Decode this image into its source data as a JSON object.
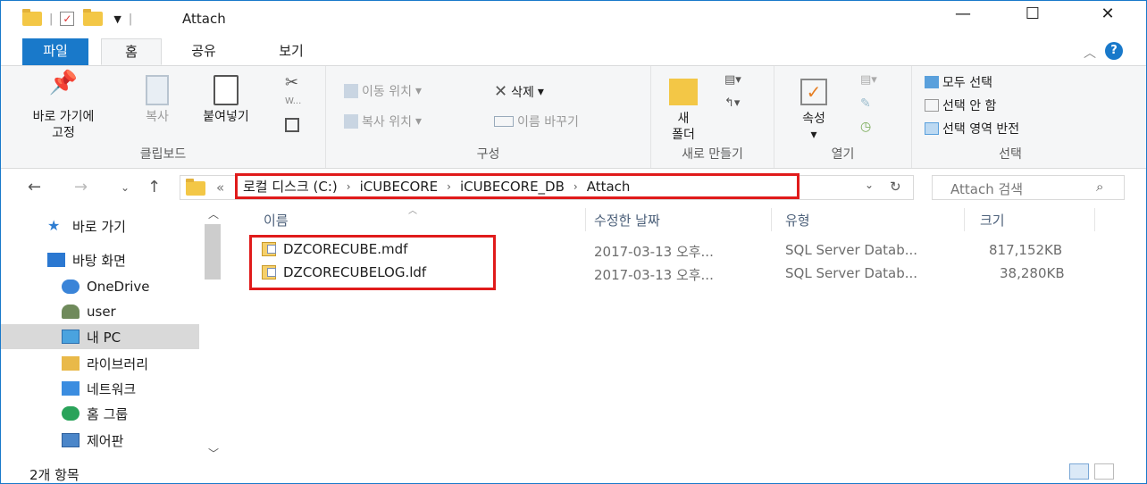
{
  "window": {
    "title": "Attach",
    "minimize": "—",
    "maximize": "☐",
    "close": "✕"
  },
  "tabs": [
    {
      "label": "파일"
    },
    {
      "label": "홈"
    },
    {
      "label": "공유"
    },
    {
      "label": "보기"
    }
  ],
  "ribbon": {
    "clipboard": {
      "pin_line1": "바로 가기에",
      "pin_line2": "고정",
      "copy": "복사",
      "paste": "붙여넣기",
      "group": "클립보드"
    },
    "organize": {
      "move_to": "이동 위치",
      "copy_to": "복사 위치",
      "delete": "삭제",
      "rename": "이름 바꾸기",
      "group": "구성"
    },
    "new": {
      "new_folder_line1": "새",
      "new_folder_line2": "폴더",
      "group": "새로 만들기"
    },
    "open": {
      "properties": "속성",
      "group": "열기"
    },
    "select": {
      "select_all": "모두 선택",
      "select_none": "선택 안 함",
      "invert": "선택 영역 반전",
      "group": "선택"
    }
  },
  "address": {
    "prefix": "«",
    "crumbs": [
      "로컬 디스크 (C:)",
      "iCUBECORE",
      "iCUBECORE_DB",
      "Attach"
    ],
    "search_placeholder": "Attach 검색"
  },
  "nav": [
    {
      "label": "바로 가기",
      "icon": "star-icon"
    },
    {
      "label": "바탕 화면",
      "icon": "desktop-icon"
    },
    {
      "label": "OneDrive",
      "icon": "cloud-icon"
    },
    {
      "label": "user",
      "icon": "user-icon"
    },
    {
      "label": "내 PC",
      "icon": "pc-icon"
    },
    {
      "label": "라이브러리",
      "icon": "library-icon"
    },
    {
      "label": "네트워크",
      "icon": "network-icon"
    },
    {
      "label": "홈 그룹",
      "icon": "homegroup-icon"
    },
    {
      "label": "제어판",
      "icon": "control-panel-icon"
    }
  ],
  "columns": {
    "name": "이름",
    "date": "수정한 날짜",
    "type": "유형",
    "size": "크기"
  },
  "files": [
    {
      "name": "DZCORECUBE.mdf",
      "date": "2017-03-13 오후...",
      "type": "SQL Server Datab...",
      "size": "817,152KB"
    },
    {
      "name": "DZCORECUBELOG.ldf",
      "date": "2017-03-13 오후...",
      "type": "SQL Server Datab...",
      "size": "38,280KB"
    }
  ],
  "status": "2개 항목"
}
